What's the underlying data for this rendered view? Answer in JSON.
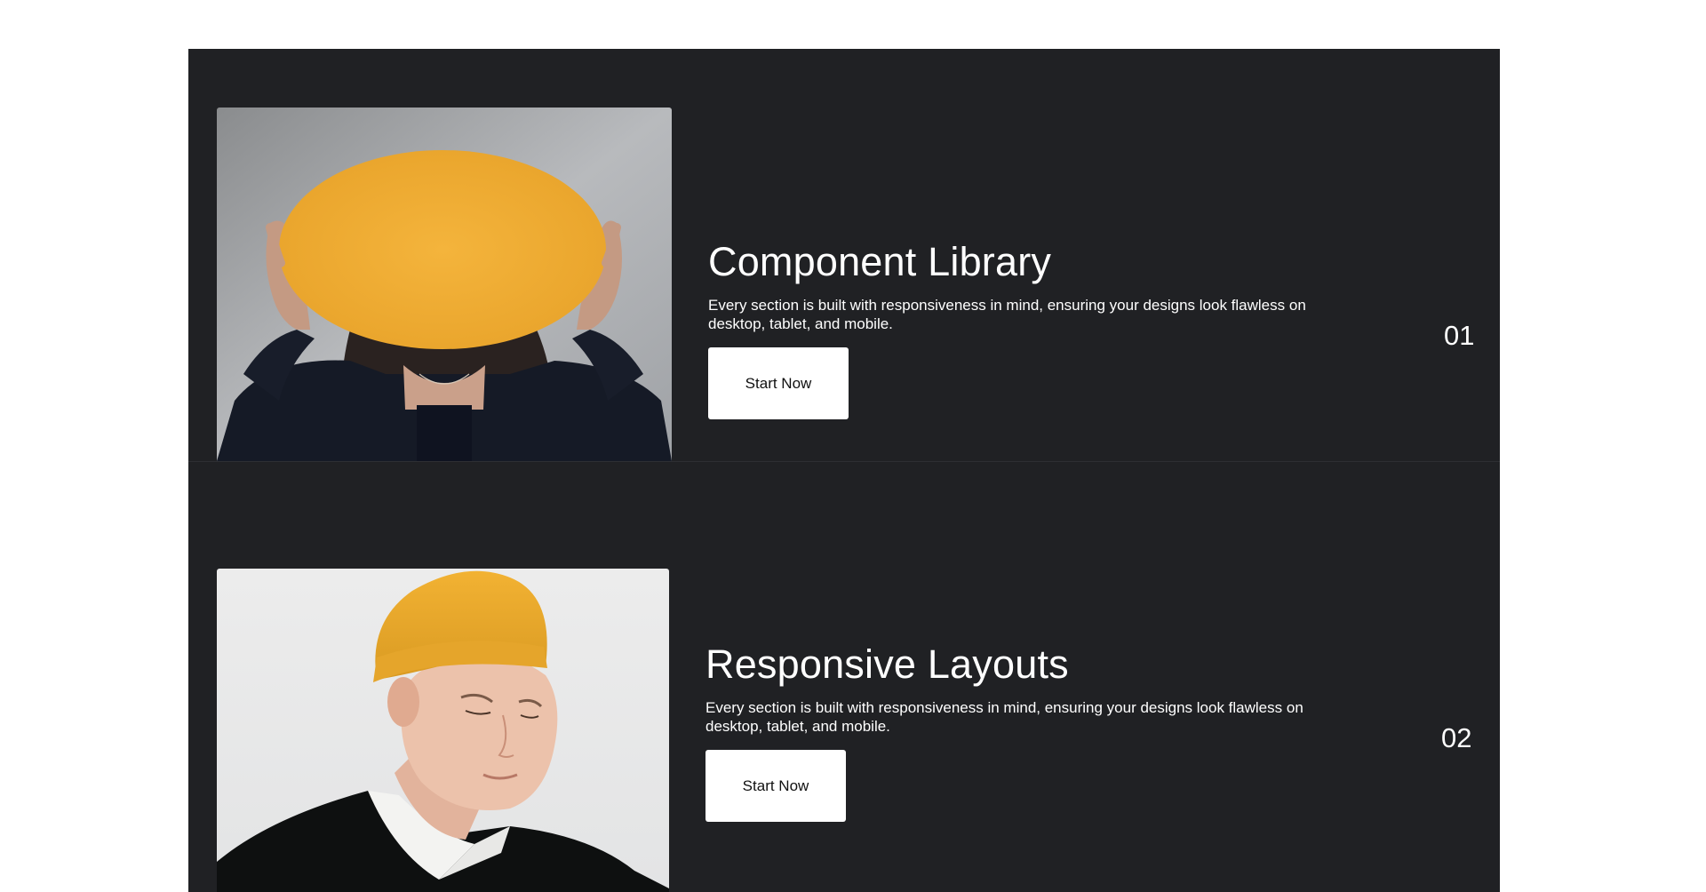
{
  "features": [
    {
      "image_desc": "woman-holding-yellow-oval",
      "title": "Component Library",
      "description": "Every section is built with responsiveness in mind, ensuring your designs look flawless on desktop, tablet, and mobile.",
      "cta_label": "Start Now",
      "number": "01"
    },
    {
      "image_desc": "man-in-yellow-beanie",
      "title": "Responsive Layouts",
      "description": "Every section is built with responsiveness in mind, ensuring your designs look flawless on desktop, tablet, and mobile.",
      "cta_label": "Start Now",
      "number": "02"
    }
  ],
  "colors": {
    "background": "#202124",
    "accent_yellow": "#f2b035",
    "text": "#ffffff",
    "button_bg": "#ffffff"
  }
}
